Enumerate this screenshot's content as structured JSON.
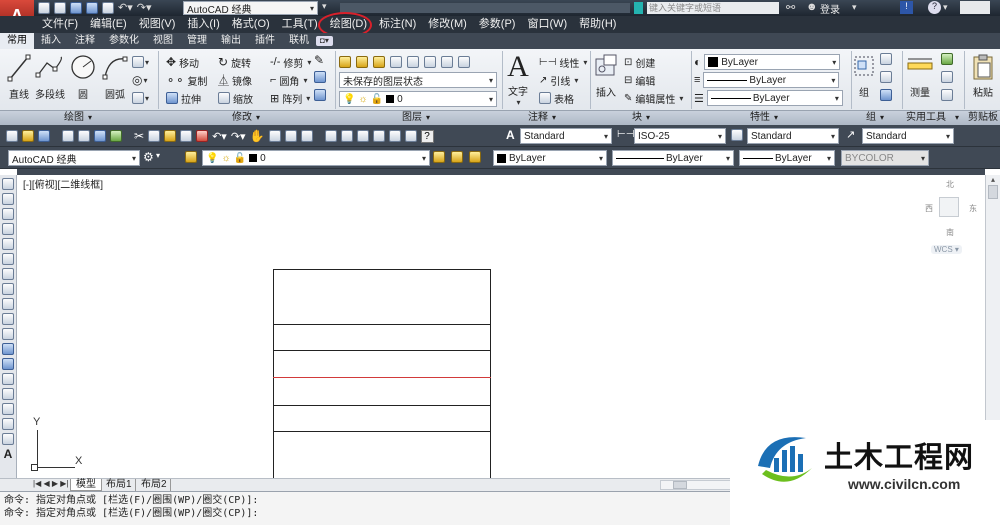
{
  "title_bar": {
    "workspace": "AutoCAD 经典",
    "search_placeholder": "键入关键字或短语",
    "login": "登录"
  },
  "menu": [
    "文件(F)",
    "编辑(E)",
    "视图(V)",
    "插入(I)",
    "格式(O)",
    "工具(T)",
    "绘图(D)",
    "标注(N)",
    "修改(M)",
    "参数(P)",
    "窗口(W)",
    "帮助(H)"
  ],
  "ribbon_tabs": [
    "常用",
    "插入",
    "注释",
    "参数化",
    "视图",
    "管理",
    "输出",
    "插件",
    "联机"
  ],
  "draw_panel": {
    "line": "直线",
    "pline": "多段线",
    "circle": "圆",
    "arc": "圆弧",
    "label": "绘图"
  },
  "modify_panel": {
    "move": "移动",
    "rotate": "旋转",
    "trim": "修剪",
    "copy": "复制",
    "mirror": "镜像",
    "fillet": "圆角",
    "stretch": "拉伸",
    "scale": "缩放",
    "array": "阵列",
    "label": "修改"
  },
  "layer_panel": {
    "state": "未保存的图层状态",
    "layer": "0",
    "label": "图层"
  },
  "annotation_panel": {
    "text": "文字",
    "linear": "线性",
    "leader": "引线",
    "table": "表格",
    "label": "注释"
  },
  "block_panel": {
    "insert": "插入",
    "create": "创建",
    "edit": "编辑",
    "edit_attr": "编辑属性",
    "label": "块"
  },
  "props_panel": {
    "color": "ByLayer",
    "linetype": "ByLayer",
    "lineweight": "ByLayer",
    "label": "特性"
  },
  "group_panel": {
    "group": "组",
    "label": "组"
  },
  "util_panel": {
    "measure": "测量",
    "label": "实用工具"
  },
  "clip_panel": {
    "paste": "粘贴",
    "label": "剪贴板"
  },
  "styles_toolbar": {
    "text_style": "Standard",
    "dim_style": "ISO-25",
    "table_style": "Standard",
    "mleader_style": "Standard"
  },
  "workspace_toolbar": {
    "workspace": "AutoCAD 经典",
    "layer": "0"
  },
  "props_toolbar": {
    "color": "ByLayer",
    "linetype": "ByLayer",
    "lineweight": "ByLayer",
    "plotstyle": "BYCOLOR"
  },
  "viewport_label": "[-][俯视][二维线框]",
  "viewcube": {
    "north": "北",
    "south": "南",
    "west": "西",
    "east": "东",
    "wcs": "WCS"
  },
  "layout_tabs": [
    "模型",
    "布局1",
    "布局2"
  ],
  "command_lines": [
    "命令: 指定对角点或 [栏选(F)/圈围(WP)/圈交(CP)]:",
    "命令: 指定对角点或 [栏选(F)/圈围(WP)/圈交(CP)]:"
  ],
  "watermark": {
    "cn": "土木工程网",
    "url": "www.civilcn.com"
  },
  "ucs": {
    "x": "X",
    "y": "Y"
  },
  "colors": {
    "highlight_circle": "#d8202a",
    "red_line": "#d23a3a",
    "logo_blue": "#1b6fb5",
    "logo_green": "#6cbf1e"
  }
}
